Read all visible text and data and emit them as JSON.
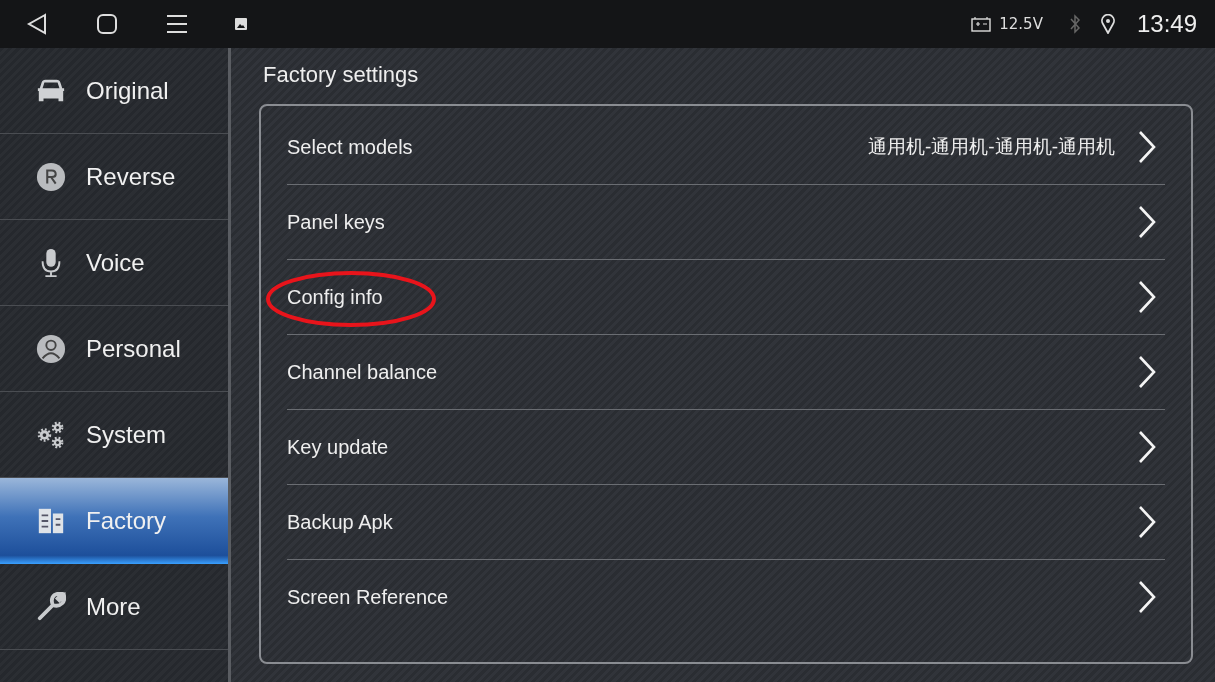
{
  "status_bar": {
    "battery": "12.5V",
    "time": "13:49",
    "bluetooth_on": false
  },
  "sidebar": {
    "items": [
      {
        "kind": "car",
        "label": "Original",
        "selected": false
      },
      {
        "kind": "reverse",
        "label": "Reverse",
        "selected": false
      },
      {
        "kind": "mic",
        "label": "Voice",
        "selected": false
      },
      {
        "kind": "person",
        "label": "Personal",
        "selected": false
      },
      {
        "kind": "gears",
        "label": "System",
        "selected": false
      },
      {
        "kind": "factory",
        "label": "Factory",
        "selected": true
      },
      {
        "kind": "wrench",
        "label": "More",
        "selected": false
      }
    ]
  },
  "title": "Factory settings",
  "rows": [
    {
      "label": "Select models",
      "value": "通用机-通用机-通用机-通用机",
      "circled": false
    },
    {
      "label": "Panel keys",
      "circled": false
    },
    {
      "label": "Config info",
      "circled": true
    },
    {
      "label": "Channel balance",
      "circled": false
    },
    {
      "label": "Key update",
      "circled": false
    },
    {
      "label": "Backup Apk",
      "circled": false
    },
    {
      "label": "Screen Reference",
      "circled": false
    }
  ]
}
